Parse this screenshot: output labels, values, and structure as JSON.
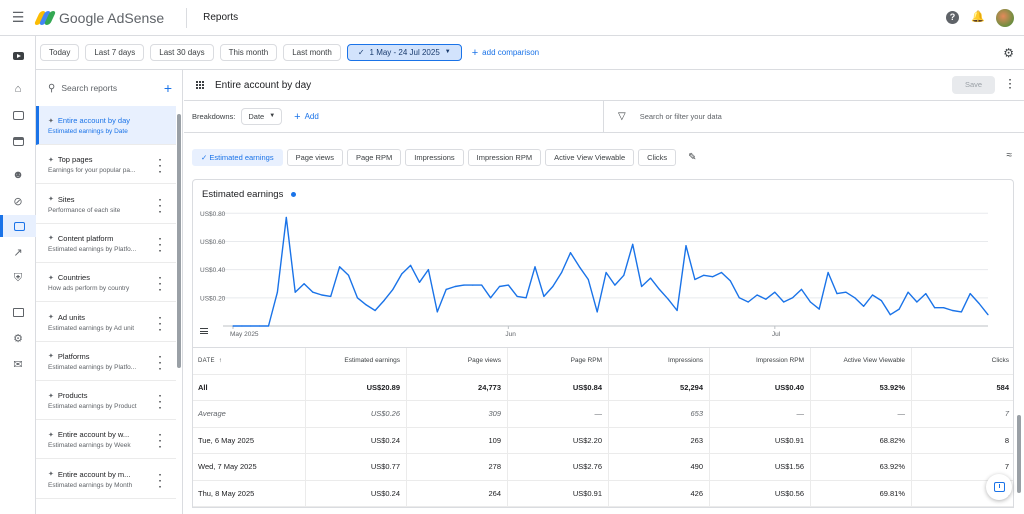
{
  "app": {
    "name_google": "Google",
    "name_product": "AdSense",
    "page_title": "Reports",
    "brand_colors": [
      "#fbbc04",
      "#4285f4",
      "#34a853"
    ]
  },
  "rail": {
    "icons": [
      "youtube-icon",
      "home-icon",
      "sites-icon",
      "ads-icon",
      "account-icon",
      "block-icon",
      "reports-icon",
      "optimize-icon",
      "privacy-icon",
      "payments-icon",
      "settings-icon",
      "feedback-icon"
    ],
    "active": "reports-icon"
  },
  "date_range": {
    "presets": [
      "Today",
      "Last 7 days",
      "Last 30 days",
      "This month",
      "Last month"
    ],
    "selected": "1 May - 24 Jul 2025",
    "add_comparison": "add comparison"
  },
  "sidebar": {
    "search_placeholder": "Search reports",
    "reports": [
      {
        "title": "Entire account by day",
        "subtitle": "Estimated earnings by Date",
        "active": true
      },
      {
        "title": "Top pages",
        "subtitle": "Earnings for your popular pa..."
      },
      {
        "title": "Sites",
        "subtitle": "Performance of each site"
      },
      {
        "title": "Content platform",
        "subtitle": "Estimated earnings by Platfo..."
      },
      {
        "title": "Countries",
        "subtitle": "How ads perform by country"
      },
      {
        "title": "Ad units",
        "subtitle": "Estimated earnings by Ad unit"
      },
      {
        "title": "Platforms",
        "subtitle": "Estimated earnings by Platfo..."
      },
      {
        "title": "Products",
        "subtitle": "Estimated earnings by Product"
      },
      {
        "title": "Entire account by w...",
        "subtitle": "Estimated earnings by Week"
      },
      {
        "title": "Entire account by m...",
        "subtitle": "Estimated earnings by Month"
      }
    ]
  },
  "report": {
    "title": "Entire account by day",
    "save_label": "Save",
    "breakdowns_label": "Breakdowns:",
    "breakdown_value": "Date",
    "add_label": "Add",
    "filter_placeholder": "Search or filter your data",
    "metrics": [
      "Estimated earnings",
      "Page views",
      "Page RPM",
      "Impressions",
      "Impression RPM",
      "Active View Viewable",
      "Clicks"
    ],
    "selected_metric": "Estimated earnings"
  },
  "chart_data": {
    "type": "line",
    "title": "Estimated earnings",
    "series_color": "#1a73e8",
    "y_tick_labels": [
      "US$0.20",
      "US$0.40",
      "US$0.60",
      "US$0.80"
    ],
    "y_ticks": [
      0.2,
      0.4,
      0.6,
      0.8
    ],
    "ylim": [
      0,
      0.88
    ],
    "x_tick_labels": [
      "May 2025",
      "Jun",
      "Jul"
    ],
    "x_tick_index": [
      0,
      31,
      61
    ],
    "grid": true,
    "series": [
      {
        "values": [
          0.0,
          0.0,
          0.0,
          0.0,
          0.0,
          0.24,
          0.77,
          0.24,
          0.3,
          0.24,
          0.22,
          0.21,
          0.42,
          0.36,
          0.2,
          0.15,
          0.11,
          0.18,
          0.26,
          0.37,
          0.43,
          0.31,
          0.4,
          0.1,
          0.26,
          0.28,
          0.29,
          0.29,
          0.29,
          0.2,
          0.28,
          0.29,
          0.21,
          0.2,
          0.42,
          0.21,
          0.28,
          0.38,
          0.52,
          0.42,
          0.33,
          0.1,
          0.38,
          0.29,
          0.36,
          0.58,
          0.28,
          0.34,
          0.26,
          0.19,
          0.11,
          0.57,
          0.33,
          0.36,
          0.35,
          0.38,
          0.32,
          0.2,
          0.17,
          0.22,
          0.19,
          0.24,
          0.17,
          0.2,
          0.26,
          0.17,
          0.12,
          0.38,
          0.23,
          0.24,
          0.2,
          0.14,
          0.22,
          0.18,
          0.08,
          0.12,
          0.24,
          0.17,
          0.23,
          0.13,
          0.13,
          0.11,
          0.1,
          0.23,
          0.16,
          0.08
        ]
      }
    ]
  },
  "table": {
    "columns": [
      "DATE",
      "Estimated earnings",
      "Page views",
      "Page RPM",
      "Impressions",
      "Impression RPM",
      "Active View Viewable",
      "Clicks"
    ],
    "total": [
      "All",
      "US$20.89",
      "24,773",
      "US$0.84",
      "52,294",
      "US$0.40",
      "53.92%",
      "584"
    ],
    "average": [
      "Average",
      "US$0.26",
      "309",
      "—",
      "653",
      "—",
      "—",
      "7"
    ],
    "rows": [
      [
        "Tue, 6 May 2025",
        "US$0.24",
        "109",
        "US$2.20",
        "263",
        "US$0.91",
        "68.82%",
        "8"
      ],
      [
        "Wed, 7 May 2025",
        "US$0.77",
        "278",
        "US$2.76",
        "490",
        "US$1.56",
        "63.92%",
        "7"
      ],
      [
        "Thu, 8 May 2025",
        "US$0.24",
        "264",
        "US$0.91",
        "426",
        "US$0.56",
        "69.81%",
        "2"
      ]
    ]
  }
}
